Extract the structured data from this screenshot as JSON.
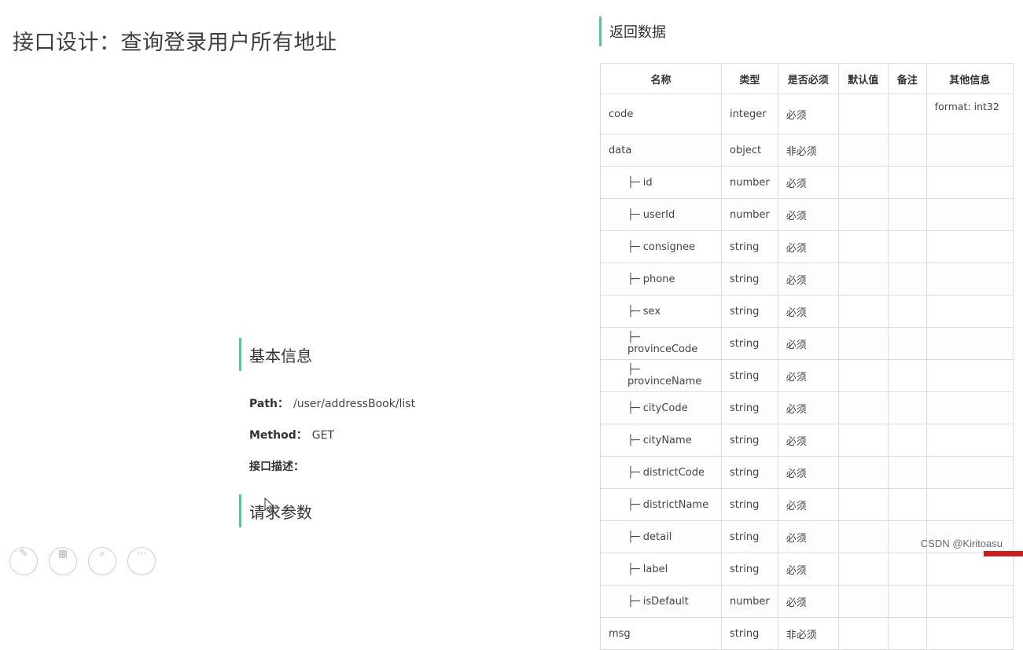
{
  "page_title": "接口设计：查询登录用户所有地址",
  "sections": {
    "basic_info": "基本信息",
    "request_params": "请求参数",
    "return_data": "返回数据"
  },
  "basic": {
    "path_label": "Path：",
    "path_value": "/user/addressBook/list",
    "method_label": "Method：",
    "method_value": "GET",
    "desc_label": "接口描述："
  },
  "table": {
    "headers": [
      "名称",
      "类型",
      "是否必须",
      "默认值",
      "备注",
      "其他信息"
    ],
    "rows": [
      {
        "name": "code",
        "type": "integer",
        "required": "必须",
        "default": "",
        "note": "",
        "other": "format: int32"
      },
      {
        "name": "data",
        "type": "object",
        "required": "非必须",
        "default": "",
        "note": "",
        "other": ""
      },
      {
        "name": "├─ id",
        "type": "number",
        "required": "必须",
        "default": "",
        "note": "",
        "other": ""
      },
      {
        "name": "├─ userId",
        "type": "number",
        "required": "必须",
        "default": "",
        "note": "",
        "other": ""
      },
      {
        "name": "├─ consignee",
        "type": "string",
        "required": "必须",
        "default": "",
        "note": "",
        "other": ""
      },
      {
        "name": "├─ phone",
        "type": "string",
        "required": "必须",
        "default": "",
        "note": "",
        "other": ""
      },
      {
        "name": "├─ sex",
        "type": "string",
        "required": "必须",
        "default": "",
        "note": "",
        "other": ""
      },
      {
        "name": "├─ provinceCode",
        "type": "string",
        "required": "必须",
        "default": "",
        "note": "",
        "other": ""
      },
      {
        "name": "├─ provinceName",
        "type": "string",
        "required": "必须",
        "default": "",
        "note": "",
        "other": ""
      },
      {
        "name": "├─ cityCode",
        "type": "string",
        "required": "必须",
        "default": "",
        "note": "",
        "other": ""
      },
      {
        "name": "├─ cityName",
        "type": "string",
        "required": "必须",
        "default": "",
        "note": "",
        "other": ""
      },
      {
        "name": "├─ districtCode",
        "type": "string",
        "required": "必须",
        "default": "",
        "note": "",
        "other": ""
      },
      {
        "name": "├─ districtName",
        "type": "string",
        "required": "必须",
        "default": "",
        "note": "",
        "other": ""
      },
      {
        "name": "├─ detail",
        "type": "string",
        "required": "必须",
        "default": "",
        "note": "",
        "other": ""
      },
      {
        "name": "├─ label",
        "type": "string",
        "required": "必须",
        "default": "",
        "note": "",
        "other": ""
      },
      {
        "name": "├─ isDefault",
        "type": "number",
        "required": "必须",
        "default": "",
        "note": "",
        "other": ""
      },
      {
        "name": "msg",
        "type": "string",
        "required": "非必须",
        "default": "",
        "note": "",
        "other": ""
      }
    ]
  },
  "watermark": "CSDN @Kiritoasu",
  "colors": {
    "accent": "#59c4a3",
    "corner": "#c62020"
  }
}
